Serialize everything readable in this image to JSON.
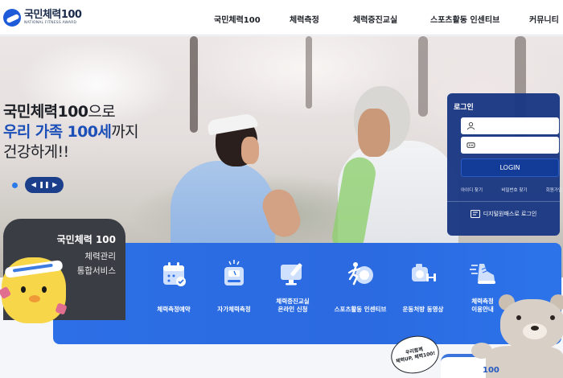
{
  "header": {
    "logo_title": "국민체력100",
    "logo_sub": "NATIONAL FITNESS AWARD",
    "nav": [
      "국민체력100",
      "체력측정",
      "체력증진교실",
      "스포츠활동 인센티브",
      "커뮤니티"
    ]
  },
  "hero": {
    "line1_bold": "국민체력100",
    "line1_rest": "으로",
    "line2_blue": "우리 가족 100세",
    "line2_rest": "까지",
    "line3": "건강하게!!",
    "controls": {
      "prev": "◀",
      "pause": "❚❚",
      "next": "▶"
    }
  },
  "login": {
    "title": "로그인",
    "id_placeholder": "",
    "pw_placeholder": "",
    "button": "LOGIN",
    "links": [
      "아이디 찾기",
      "비밀번호 찾기",
      "회원가입"
    ],
    "digital": "디지털원패스로 로그인"
  },
  "card": {
    "title": "국민체력 100",
    "sub1": "체력관리",
    "sub2": "통합서비스"
  },
  "services": [
    {
      "label": "체력측정예약",
      "icon": "calendar-check-icon"
    },
    {
      "label": "자가체력측정",
      "icon": "scale-icon"
    },
    {
      "label": "체력증진교실\n온라인 신청",
      "line1": "체력증진교실",
      "line2": "온라인 신청",
      "icon": "monitor-pen-icon"
    },
    {
      "label": "스포츠활동 인센티브",
      "icon": "runner-coin-icon"
    },
    {
      "label": "운동처방 동영상",
      "icon": "camera-dumbbell-icon"
    },
    {
      "label": "체력측정\n이용안내",
      "line1": "체력측정",
      "line2": "이용안내",
      "icon": "shoe-icon"
    }
  ],
  "mascot": {
    "bubble_line1": "우리함께",
    "bubble_line2": "체력UP, 체력100!",
    "shirt_text": "100"
  },
  "colors": {
    "brand_blue": "#2d6fe6",
    "login_bg": "#193782",
    "card_bg": "#3b3d44",
    "headline_blue": "#1d4fb8"
  }
}
